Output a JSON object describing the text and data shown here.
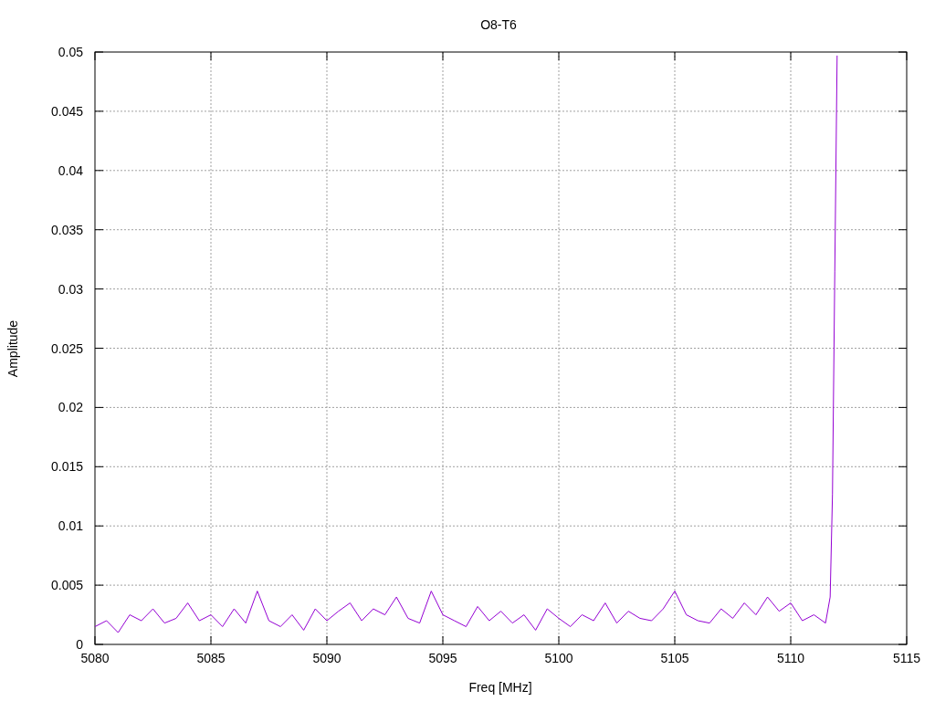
{
  "chart_data": {
    "type": "line",
    "title": "O8-T6",
    "xlabel": "Freq [MHz]",
    "ylabel": "Amplitude",
    "x": [
      5080,
      5080.5,
      5081,
      5081.5,
      5082,
      5082.5,
      5083,
      5083.5,
      5084,
      5084.5,
      5085,
      5085.5,
      5086,
      5086.5,
      5087,
      5087.5,
      5088,
      5088.5,
      5089,
      5089.5,
      5090,
      5090.5,
      5091,
      5091.5,
      5092,
      5092.5,
      5093,
      5093.5,
      5094,
      5094.5,
      5095,
      5095.5,
      5096,
      5096.5,
      5097,
      5097.5,
      5098,
      5098.5,
      5099,
      5099.5,
      5100,
      5100.5,
      5101,
      5101.5,
      5102,
      5102.5,
      5103,
      5103.5,
      5104,
      5104.5,
      5105,
      5105.5,
      5106,
      5106.5,
      5107,
      5107.5,
      5108,
      5108.5,
      5109,
      5109.5,
      5110,
      5110.5,
      5111,
      5111.5,
      5111.7,
      5111.8,
      5111.9,
      5112
    ],
    "series": [
      {
        "color": "#9400d3",
        "values": [
          0.0015,
          0.002,
          0.001,
          0.0025,
          0.002,
          0.003,
          0.0018,
          0.0022,
          0.0035,
          0.002,
          0.0025,
          0.0015,
          0.003,
          0.0018,
          0.0045,
          0.002,
          0.0015,
          0.0025,
          0.0012,
          0.003,
          0.002,
          0.0028,
          0.0035,
          0.002,
          0.003,
          0.0025,
          0.004,
          0.0022,
          0.0018,
          0.0045,
          0.0025,
          0.002,
          0.0015,
          0.0032,
          0.002,
          0.0028,
          0.0018,
          0.0025,
          0.0012,
          0.003,
          0.0022,
          0.0015,
          0.0025,
          0.002,
          0.0035,
          0.0018,
          0.0028,
          0.0022,
          0.002,
          0.003,
          0.0045,
          0.0025,
          0.002,
          0.0018,
          0.003,
          0.0022,
          0.0035,
          0.0025,
          0.004,
          0.0028,
          0.0035,
          0.002,
          0.0025,
          0.0018,
          0.004,
          0.0127,
          0.0315,
          0.0497
        ]
      }
    ],
    "grid": true,
    "xlim": [
      5080,
      5115
    ],
    "ylim": [
      0,
      0.05
    ],
    "xticks": [
      5080,
      5085,
      5090,
      5095,
      5100,
      5105,
      5110,
      5115
    ],
    "yticks": [
      0,
      0.005,
      0.01,
      0.015,
      0.02,
      0.025,
      0.03,
      0.035,
      0.04,
      0.045,
      0.05
    ]
  }
}
